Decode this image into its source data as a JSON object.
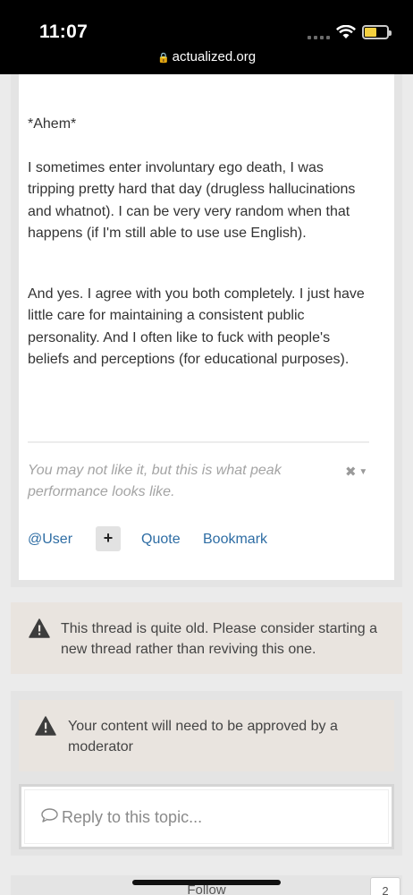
{
  "status_bar": {
    "time": "11:07",
    "url": "actualized.org"
  },
  "post": {
    "paragraphs": [
      "*Ahem*",
      "I sometimes enter involuntary ego death, I was tripping pretty hard that day (drugless hallucinations and whatnot).  I can be very very random when that happens (if I'm still able to use use English).",
      "And yes.  I agree with you both completely.  I just have little care for maintaining a consistent public personality.  And I often like to fuck with people's beliefs and perceptions (for educational purposes)."
    ],
    "signature": "You may not like it, but this is what peak performance looks like.",
    "actions": {
      "user": "@User",
      "plus": "+",
      "quote": "Quote",
      "bookmark": "Bookmark"
    }
  },
  "notices": {
    "old_thread": "This thread is quite old. Please consider starting a new thread rather than reviving this one.",
    "approval": "Your content will need to be approved by a moderator"
  },
  "reply": {
    "placeholder": "Reply to this topic..."
  },
  "footer": {
    "follow_label": "Follow",
    "follow_count": "2"
  },
  "icons": [
    "lock-icon",
    "wifi-icon",
    "battery-icon",
    "warning-icon",
    "comment-icon",
    "close-icon",
    "chevron-down-icon"
  ]
}
